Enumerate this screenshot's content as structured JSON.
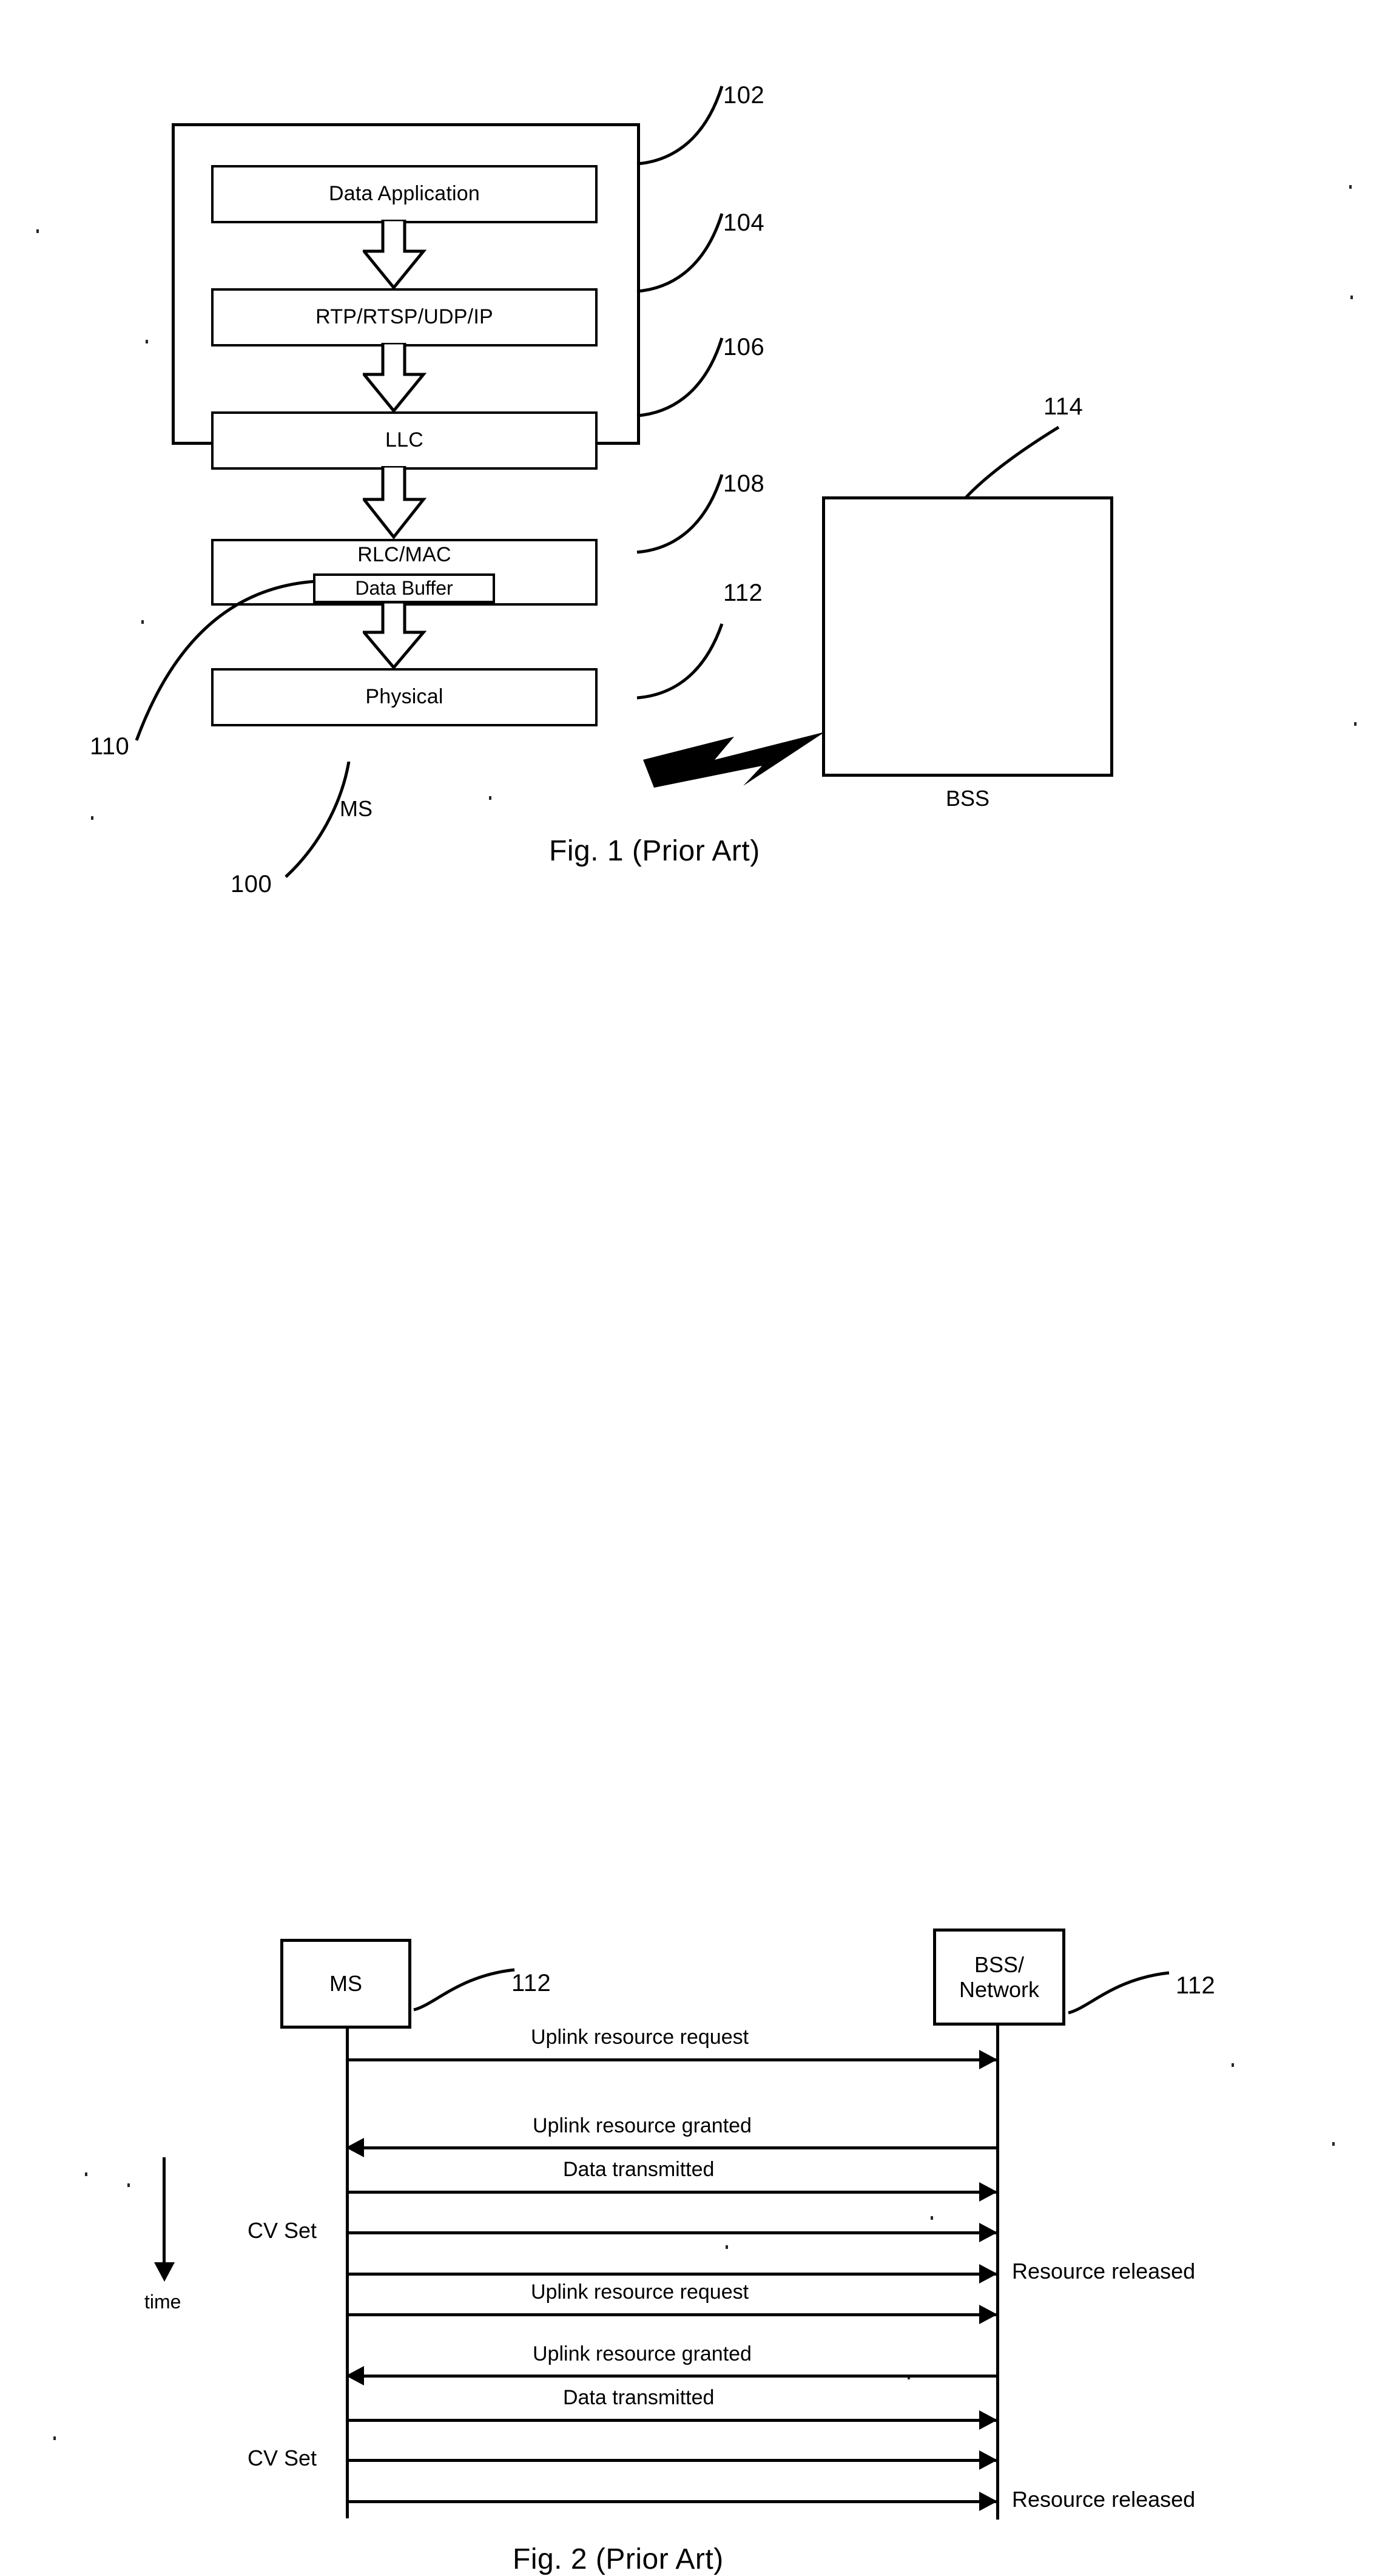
{
  "figure1": {
    "caption": "Fig. 1 (Prior Art)",
    "ms_label": "MS",
    "bss_label": "BSS",
    "layers": [
      {
        "label": "Data Application",
        "ref": "102"
      },
      {
        "label": "RTP/RTSP/UDP/IP",
        "ref": "104"
      },
      {
        "label": "LLC",
        "ref": "106"
      },
      {
        "label": "RLC/MAC",
        "ref": "108"
      },
      {
        "label": "Physical",
        "ref": "112"
      }
    ],
    "data_buffer_label": "Data Buffer",
    "refs": {
      "data_application": "102",
      "rtp_stack": "104",
      "llc": "106",
      "rlc_mac": "108",
      "physical": "112",
      "bss": "114",
      "data_buffer": "110",
      "ms": "100"
    }
  },
  "figure2": {
    "caption": "Fig. 2 (Prior Art)",
    "ms_label": "MS",
    "network_label_line1": "BSS/",
    "network_label_line2": "Network",
    "ms_ref": "112",
    "network_ref": "112",
    "time_axis_label": "time",
    "cv_set_label_1": "CV Set",
    "cv_set_label_2": "CV Set",
    "resource_released_label_1": "Resource released",
    "resource_released_label_2": "Resource released",
    "messages": [
      {
        "label": "Uplink resource request",
        "direction": "right"
      },
      {
        "label": "Uplink resource granted",
        "direction": "left"
      },
      {
        "label": "Data transmitted",
        "direction": "right"
      },
      {
        "label": "",
        "direction": "right"
      },
      {
        "label": "",
        "direction": "right"
      },
      {
        "label": "Uplink resource request",
        "direction": "right"
      },
      {
        "label": "Uplink resource granted",
        "direction": "left"
      },
      {
        "label": "Data transmitted",
        "direction": "right"
      },
      {
        "label": "",
        "direction": "right"
      },
      {
        "label": "",
        "direction": "right"
      }
    ]
  },
  "colors": {
    "ink": "#000000",
    "paper": "#ffffff"
  }
}
